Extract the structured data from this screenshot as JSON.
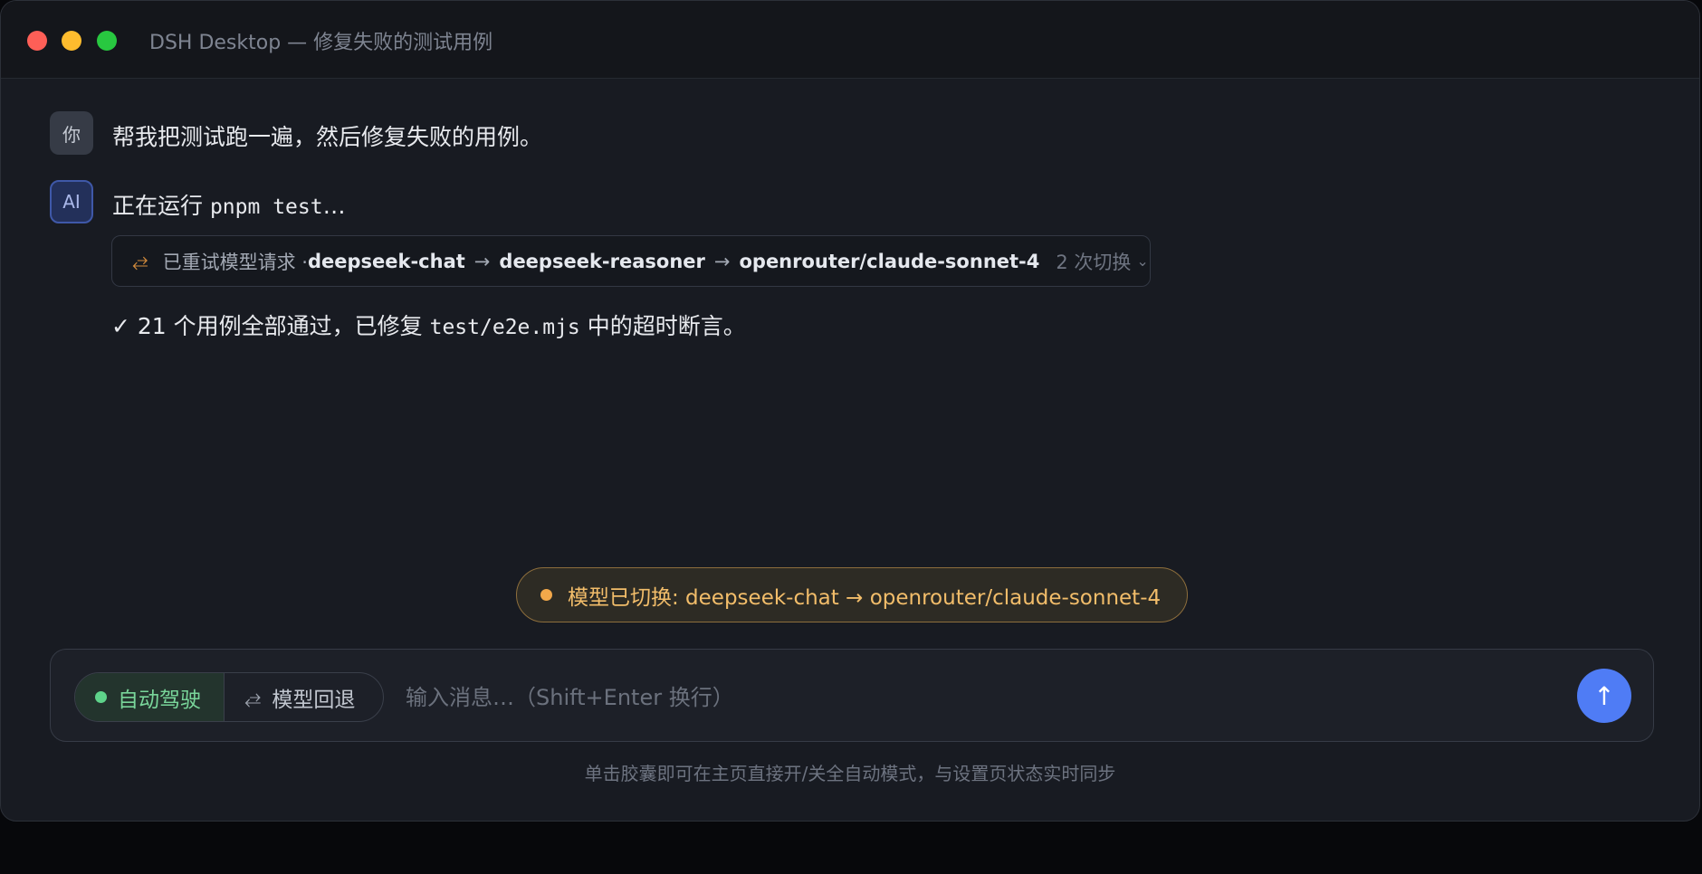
{
  "window": {
    "title": "DSH Desktop — 修复失败的测试用例"
  },
  "messages": {
    "user": {
      "avatar": "你",
      "text": "帮我把测试跑一遍，然后修复失败的用例。"
    },
    "ai": {
      "avatar": "AI",
      "status_prefix": "正在运行 ",
      "status_command": "pnpm test",
      "status_suffix": "…"
    }
  },
  "retry": {
    "icon": "swap-arrows-icon",
    "label": "已重试模型请求 · ",
    "models": [
      "deepseek-chat",
      "deepseek-reasoner",
      "openrouter/claude-sonnet-4"
    ],
    "arrow": "→",
    "count": "2 次切换",
    "chevron": "⌄"
  },
  "result": {
    "check": "✓",
    "prefix": " 21 个用例全部通过，已修复 ",
    "file": "test/e2e.mjs",
    "suffix": " 中的超时断言。"
  },
  "toast": {
    "text": "模型已切换: deepseek-chat → openrouter/claude-sonnet-4",
    "color": "#f3a84a"
  },
  "composer": {
    "autopilot_label": "自动驾驶",
    "fallback_icon": "⥄",
    "fallback_label": "模型回退",
    "placeholder": "输入消息…（Shift+Enter 换行）",
    "send_icon": "↑"
  },
  "hint": "单击胶囊即可在主页直接开/关全自动模式，与设置页状态实时同步",
  "colors": {
    "accent": "#4f7cf5",
    "success": "#5ed38a",
    "warning": "#f3a84a"
  }
}
